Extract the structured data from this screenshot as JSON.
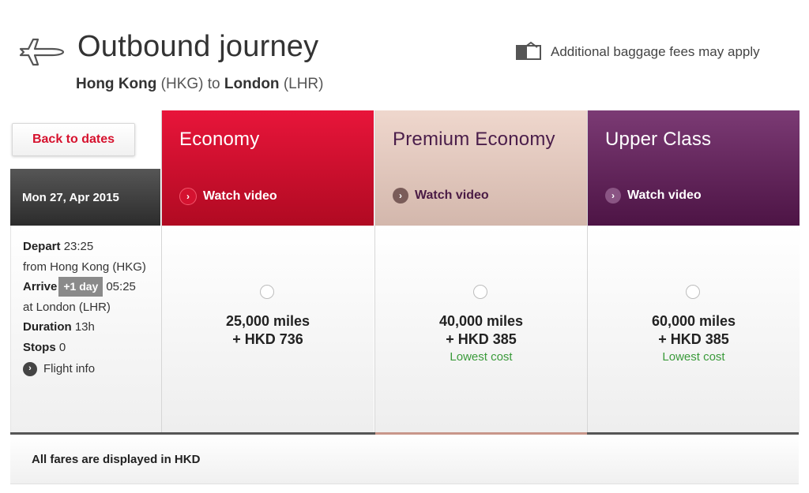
{
  "header": {
    "title": "Outbound journey",
    "route": {
      "origin_city": "Hong Kong",
      "origin_code": "(HKG)",
      "connector": "to",
      "dest_city": "London",
      "dest_code": "(LHR)"
    },
    "baggage_note": "Additional baggage fees may apply",
    "icons": {
      "plane": "plane-icon",
      "baggage": "baggage-icon"
    }
  },
  "sidebar": {
    "back_label": "Back to dates",
    "date": "Mon 27, Apr 2015",
    "flight": {
      "depart_label": "Depart",
      "depart_time": "23:25",
      "from_text": "from Hong Kong (HKG)",
      "arrive_label": "Arrive",
      "plus_day": "+1 day",
      "arrive_time": "05:25",
      "at_text": "at London (LHR)",
      "duration_label": "Duration",
      "duration_value": "13h",
      "stops_label": "Stops",
      "stops_value": "0",
      "info_link": "Flight info"
    }
  },
  "fares": [
    {
      "cabin": "Economy",
      "watch_label": "Watch video",
      "miles": "25,000 miles",
      "cash": "+ HKD 736",
      "note": "",
      "selected": false,
      "color": "#d41230"
    },
    {
      "cabin": "Premium Economy",
      "watch_label": "Watch video",
      "miles": "40,000 miles",
      "cash": "+ HKD 385",
      "note": "Lowest cost",
      "selected": false,
      "color": "#d9bdb2"
    },
    {
      "cabin": "Upper Class",
      "watch_label": "Watch video",
      "miles": "60,000 miles",
      "cash": "+ HKD 385",
      "note": "Lowest cost",
      "selected": false,
      "color": "#5e1f56"
    }
  ],
  "footer": {
    "note": "All fares are displayed in HKD"
  },
  "colors": {
    "lowest_cost": "#3a9a3a",
    "back_button_text": "#d6122e",
    "premium_accent": "#c8968a"
  }
}
